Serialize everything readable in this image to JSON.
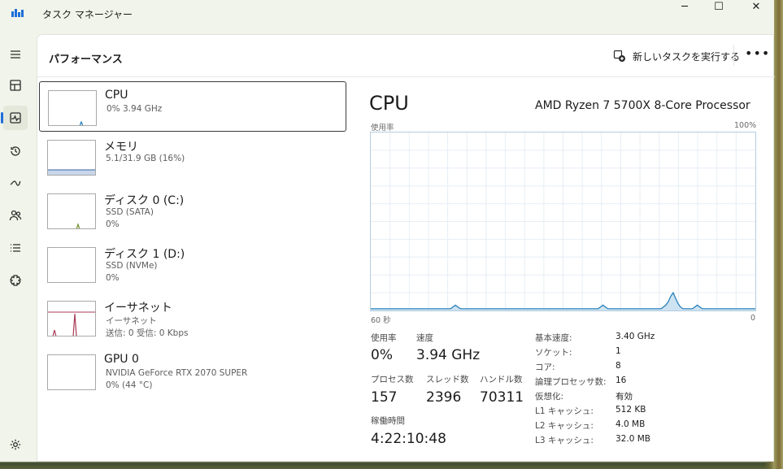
{
  "window": {
    "title": "タスク マネージャー",
    "controls": {
      "minimize": "─",
      "maximize": "☐",
      "close": "✕"
    }
  },
  "rail": {
    "items": [
      {
        "name": "hamburger-menu-icon"
      },
      {
        "name": "processes-icon"
      },
      {
        "name": "performance-icon",
        "active": true
      },
      {
        "name": "app-history-icon"
      },
      {
        "name": "startup-apps-icon"
      },
      {
        "name": "users-icon"
      },
      {
        "name": "details-icon"
      },
      {
        "name": "services-icon"
      },
      {
        "name": "settings-icon"
      }
    ]
  },
  "header": {
    "title": "パフォーマンス",
    "run_task_label": "新しいタスクを実行する",
    "more_label": "•••"
  },
  "devices": [
    {
      "name": "CPU",
      "line1": "0%  3.94 GHz",
      "line2": "",
      "thumb_color": "#1e7ab8"
    },
    {
      "name": "メモリ",
      "line1": "5.1/31.9 GB (16%)",
      "line2": "",
      "thumb_color": "#5b7fb4"
    },
    {
      "name": "ディスク 0 (C:)",
      "line1": "SSD (SATA)",
      "line2": "0%",
      "thumb_color": "#6e8f2a"
    },
    {
      "name": "ディスク 1 (D:)",
      "line1": "SSD (NVMe)",
      "line2": "0%",
      "thumb_color": "#6e8f2a"
    },
    {
      "name": "イーサネット",
      "line1": "イーサネット",
      "line2": "送信: 0 受信: 0 Kbps",
      "thumb_color": "#a83a55"
    },
    {
      "name": "GPU 0",
      "line1": "NVIDIA GeForce RTX 2070 SUPER",
      "line2": "0%  (44 °C)",
      "thumb_color": "#1e7ab8"
    }
  ],
  "detail": {
    "title": "CPU",
    "model": "AMD Ryzen 7 5700X 8-Core Processor",
    "graph": {
      "top_left": "使用率",
      "top_right": "100%",
      "bottom_left": "60 秒",
      "bottom_right": "0",
      "line_color": "#1e7ab8",
      "fill_color": "#cde3f1",
      "usage_percent_series": [
        1,
        1,
        1,
        1,
        1,
        1,
        1,
        1,
        1,
        1,
        1,
        1,
        1,
        1,
        1,
        1,
        1,
        1,
        1,
        1,
        1,
        1,
        1,
        1,
        1,
        1,
        1,
        1,
        1,
        1,
        1,
        1,
        1,
        1,
        2,
        3,
        2,
        1,
        1,
        1,
        1,
        1,
        1,
        1,
        1,
        1,
        1,
        1,
        1,
        1,
        1,
        1,
        1,
        1,
        1,
        1,
        1,
        1,
        1,
        1,
        1,
        1,
        1,
        1,
        1,
        1,
        1,
        1,
        1,
        1,
        1,
        1,
        1,
        1,
        1,
        1,
        1,
        1,
        1,
        1,
        1,
        1,
        1,
        1,
        1,
        1,
        1,
        1,
        1,
        1,
        1,
        1,
        1,
        1,
        1,
        2,
        3,
        2,
        1,
        1,
        1,
        1,
        1,
        1,
        1,
        1,
        1,
        1,
        1,
        1,
        1,
        1,
        1,
        1,
        1,
        1,
        1,
        1,
        1,
        1,
        1,
        2,
        3,
        5,
        8,
        10,
        7,
        4,
        2,
        1,
        1,
        1,
        1,
        1,
        2,
        3,
        2,
        1,
        1,
        1,
        1,
        1,
        1,
        1,
        1,
        1,
        1,
        1,
        1,
        1,
        1,
        1,
        1,
        1,
        1,
        1,
        1,
        1,
        1,
        1
      ]
    },
    "stats": {
      "usage": {
        "label": "使用率",
        "value": "0%"
      },
      "speed": {
        "label": "速度",
        "value": "3.94 GHz"
      },
      "processes": {
        "label": "プロセス数",
        "value": "157"
      },
      "threads": {
        "label": "スレッド数",
        "value": "2396"
      },
      "handles": {
        "label": "ハンドル数",
        "value": "70311"
      },
      "uptime": {
        "label": "稼働時間",
        "value": "4:22:10:48"
      }
    },
    "specs": [
      {
        "label": "基本速度:",
        "value": "3.40 GHz"
      },
      {
        "label": "ソケット:",
        "value": "1"
      },
      {
        "label": "コア:",
        "value": "8"
      },
      {
        "label": "論理プロセッサ数:",
        "value": "16"
      },
      {
        "label": "仮想化:",
        "value": "有効"
      },
      {
        "label": "L1 キャッシュ:",
        "value": "512 KB"
      },
      {
        "label": "L2 キャッシュ:",
        "value": "4.0 MB"
      },
      {
        "label": "L3 キャッシュ:",
        "value": "32.0 MB"
      }
    ]
  }
}
